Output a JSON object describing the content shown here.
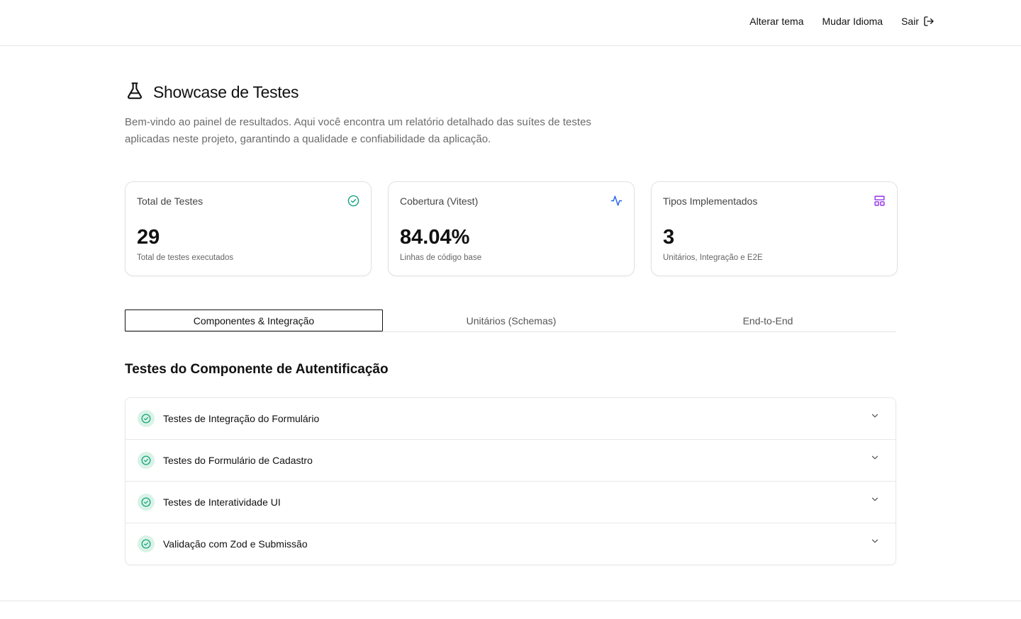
{
  "nav": {
    "theme_label": "Alterar tema",
    "language_label": "Mudar Idioma",
    "logout_label": "Sair"
  },
  "header": {
    "title": "Showcase de Testes",
    "subtitle": "Bem-vindo ao painel de resultados. Aqui você encontra um relatório detalhado das suítes de testes aplicadas neste projeto, garantindo a qualidade e confiabilidade da aplicação."
  },
  "cards": [
    {
      "label": "Total de Testes",
      "value": "29",
      "desc": "Total de testes executados",
      "icon": "check-circle-icon",
      "icon_color": "#16a37f"
    },
    {
      "label": "Cobertura (Vitest)",
      "value": "84.04%",
      "desc": "Linhas de código base",
      "icon": "activity-icon",
      "icon_color": "#2563eb"
    },
    {
      "label": "Tipos Implementados",
      "value": "3",
      "desc": "Unitários, Integração e E2E",
      "icon": "layout-icon",
      "icon_color": "#9333ea"
    }
  ],
  "tabs": [
    {
      "label": "Componentes & Integração",
      "active": true
    },
    {
      "label": "Unitários (Schemas)",
      "active": false
    },
    {
      "label": "End-to-End",
      "active": false
    }
  ],
  "section": {
    "title": "Testes do Componente de Autentificação"
  },
  "accordion": [
    {
      "label": "Testes de Integração do Formulário"
    },
    {
      "label": "Testes do Formulário de Cadastro"
    },
    {
      "label": "Testes de Interatividade UI"
    },
    {
      "label": "Validação com Zod e Submissão"
    }
  ],
  "colors": {
    "success": "#16a37f",
    "success_bg": "#d9f3e6",
    "accent_blue": "#2563eb",
    "accent_purple": "#9333ea"
  }
}
